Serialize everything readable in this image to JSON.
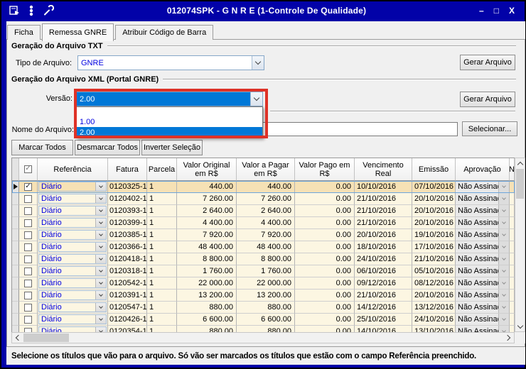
{
  "window": {
    "title": "012074SPK - G N R E (1-Controle De Qualidade)",
    "minimize": "–",
    "maximize": "□",
    "close": "X"
  },
  "tabs": {
    "ficha": "Ficha",
    "remessa": "Remessa GNRE",
    "atribuir": "Atribuir Código de Barra"
  },
  "txt_section": {
    "title": "Geração do Arquivo TXT",
    "tipo_label": "Tipo de Arquivo:",
    "tipo_value": "GNRE",
    "gerar_button": "Gerar Arquivo"
  },
  "xml_section": {
    "title": "Geração do Arquivo XML (Portal GNRE)",
    "versao_label": "Versão:",
    "versao_value": "2.00",
    "dropdown_options": [
      "",
      "1.00",
      "2.00"
    ],
    "dropdown_selected_index": 2,
    "gerar_button": "Gerar Arquivo",
    "nome_label": "Nome do Arquivo:",
    "nome_value": "",
    "selecionar_button": "Selecionar..."
  },
  "selection_buttons": {
    "marcar": "Marcar Todos",
    "desmarcar": "Desmarcar Todos",
    "inverter": "Inverter Seleção"
  },
  "table": {
    "header": {
      "referencia": "Referência",
      "fatura": "Fatura",
      "parcela": "Parcela",
      "valor_original": "Valor Original em R$",
      "valor_a_pagar": "Valor a Pagar em R$",
      "valor_pago": "Valor Pago em R$",
      "vencimento_real": "Vencimento Real",
      "emissao": "Emissão",
      "aprovacao": "Aprovação",
      "extra": "N"
    },
    "rows": [
      {
        "checked": true,
        "selected": true,
        "referencia": "Diário",
        "fatura": "0120325-1",
        "parcela": "1",
        "valor_original": "440.00",
        "valor_a_pagar": "440.00",
        "valor_pago": "0.00",
        "vencimento_real": "10/10/2016",
        "emissao": "07/10/2016",
        "aprovacao": "Não Assinado"
      },
      {
        "checked": false,
        "selected": false,
        "referencia": "Diário",
        "fatura": "0120402-1",
        "parcela": "1",
        "valor_original": "7 260.00",
        "valor_a_pagar": "7 260.00",
        "valor_pago": "0.00",
        "vencimento_real": "21/10/2016",
        "emissao": "20/10/2016",
        "aprovacao": "Não Assinado"
      },
      {
        "checked": false,
        "selected": false,
        "referencia": "Diário",
        "fatura": "0120393-1",
        "parcela": "1",
        "valor_original": "2 640.00",
        "valor_a_pagar": "2 640.00",
        "valor_pago": "0.00",
        "vencimento_real": "21/10/2016",
        "emissao": "20/10/2016",
        "aprovacao": "Não Assinado"
      },
      {
        "checked": false,
        "selected": false,
        "referencia": "Diário",
        "fatura": "0120399-1",
        "parcela": "1",
        "valor_original": "4 400.00",
        "valor_a_pagar": "4 400.00",
        "valor_pago": "0.00",
        "vencimento_real": "21/10/2016",
        "emissao": "20/10/2016",
        "aprovacao": "Não Assinado"
      },
      {
        "checked": false,
        "selected": false,
        "referencia": "Diário",
        "fatura": "0120385-1",
        "parcela": "1",
        "valor_original": "7 920.00",
        "valor_a_pagar": "7 920.00",
        "valor_pago": "0.00",
        "vencimento_real": "20/10/2016",
        "emissao": "19/10/2016",
        "aprovacao": "Não Assinado"
      },
      {
        "checked": false,
        "selected": false,
        "referencia": "Diário",
        "fatura": "0120366-1",
        "parcela": "1",
        "valor_original": "48 400.00",
        "valor_a_pagar": "48 400.00",
        "valor_pago": "0.00",
        "vencimento_real": "18/10/2016",
        "emissao": "17/10/2016",
        "aprovacao": "Não Assinado"
      },
      {
        "checked": false,
        "selected": false,
        "referencia": "Diário",
        "fatura": "0120418-1",
        "parcela": "1",
        "valor_original": "8 800.00",
        "valor_a_pagar": "8 800.00",
        "valor_pago": "0.00",
        "vencimento_real": "24/10/2016",
        "emissao": "21/10/2016",
        "aprovacao": "Não Assinado"
      },
      {
        "checked": false,
        "selected": false,
        "referencia": "Diário",
        "fatura": "0120318-1",
        "parcela": "1",
        "valor_original": "1 760.00",
        "valor_a_pagar": "1 760.00",
        "valor_pago": "0.00",
        "vencimento_real": "06/10/2016",
        "emissao": "05/10/2016",
        "aprovacao": "Não Assinado"
      },
      {
        "checked": false,
        "selected": false,
        "referencia": "Diário",
        "fatura": "0120542-1",
        "parcela": "1",
        "valor_original": "22 000.00",
        "valor_a_pagar": "22 000.00",
        "valor_pago": "0.00",
        "vencimento_real": "09/12/2016",
        "emissao": "08/12/2016",
        "aprovacao": "Não Assinado"
      },
      {
        "checked": false,
        "selected": false,
        "referencia": "Diário",
        "fatura": "0120391-1",
        "parcela": "1",
        "valor_original": "13 200.00",
        "valor_a_pagar": "13 200.00",
        "valor_pago": "0.00",
        "vencimento_real": "21/10/2016",
        "emissao": "20/10/2016",
        "aprovacao": "Não Assinado"
      },
      {
        "checked": false,
        "selected": false,
        "referencia": "Diário",
        "fatura": "0120547-1",
        "parcela": "1",
        "valor_original": "880.00",
        "valor_a_pagar": "880.00",
        "valor_pago": "0.00",
        "vencimento_real": "14/12/2016",
        "emissao": "13/12/2016",
        "aprovacao": "Não Assinado"
      },
      {
        "checked": false,
        "selected": false,
        "referencia": "Diário",
        "fatura": "0120426-1",
        "parcela": "1",
        "valor_original": "6 600.00",
        "valor_a_pagar": "6 600.00",
        "valor_pago": "0.00",
        "vencimento_real": "25/10/2016",
        "emissao": "24/10/2016",
        "aprovacao": "Não Assinado"
      },
      {
        "checked": false,
        "selected": false,
        "referencia": "Diário",
        "fatura": "0120354-1",
        "parcela": "1",
        "valor_original": "880.00",
        "valor_a_pagar": "880.00",
        "valor_pago": "0.00",
        "vencimento_real": "14/10/2016",
        "emissao": "13/10/2016",
        "aprovacao": "Não Assinado"
      }
    ]
  },
  "status_bar": {
    "message": "Selecione os títulos que vão para o arquivo. Só vão ser marcados os títulos que estão com o campo Referência preenchido."
  },
  "colors": {
    "titlebar_blue": "#0202A8",
    "selection_blue": "#0078D7",
    "annotation_red": "#DE3227",
    "row_cream": "#FCF6E2",
    "row_selected_tan": "#F6E1B5",
    "combo_text_blue": "#0000E0"
  }
}
